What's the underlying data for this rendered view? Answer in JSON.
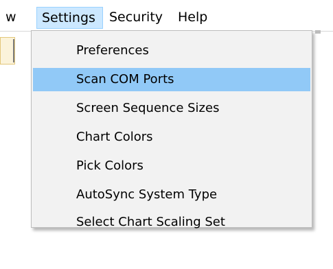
{
  "menubar": {
    "items": [
      {
        "label": "w"
      },
      {
        "label": "Settings"
      },
      {
        "label": "Security"
      },
      {
        "label": "Help"
      }
    ]
  },
  "settings_menu": {
    "items": [
      {
        "label": "Preferences"
      },
      {
        "label": "Scan COM Ports"
      },
      {
        "label": "Screen Sequence Sizes"
      },
      {
        "label": "Chart Colors"
      },
      {
        "label": "Pick Colors"
      },
      {
        "label": "AutoSync System Type"
      },
      {
        "label": "Select Chart Scaling Set"
      }
    ],
    "highlighted_item": "Scan COM Ports"
  },
  "colors": {
    "menubar_selected_bg": "#cce8ff",
    "menu_highlight_bg": "#91c9f7",
    "menu_bg": "#f2f2f2"
  }
}
